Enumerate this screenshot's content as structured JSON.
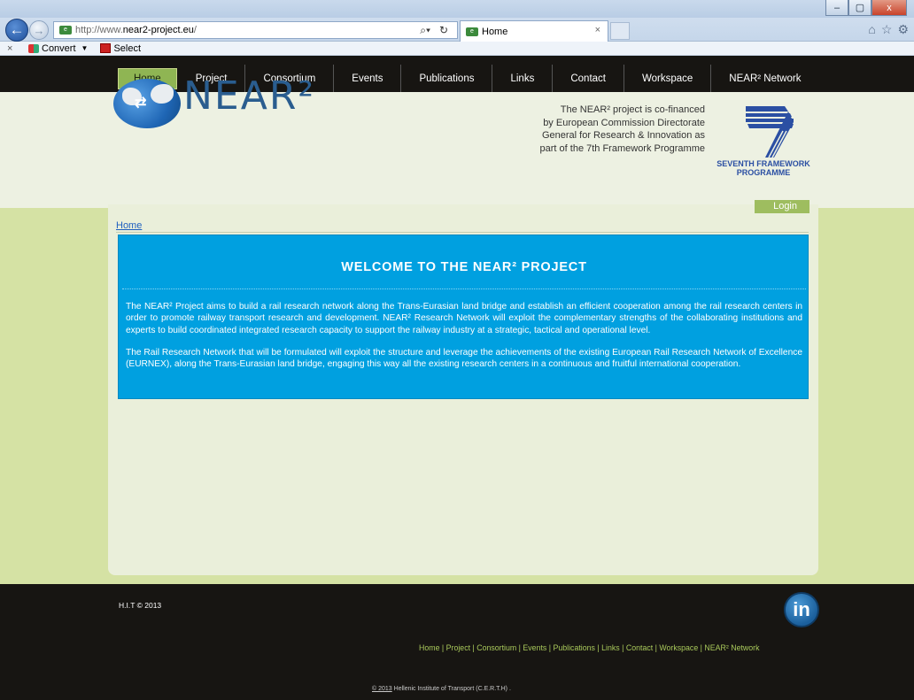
{
  "browser": {
    "url_prefix": "http://www.",
    "url_domain": "near2-project.eu",
    "url_suffix": "/",
    "tab_title": "Home",
    "window_controls": [
      "–",
      "▢",
      "x"
    ]
  },
  "command_bar": {
    "convert_label": "Convert",
    "select_label": "Select"
  },
  "site": {
    "nav": [
      "Home",
      "Project",
      "Consortium",
      "Events",
      "Publications",
      "Links",
      "Contact",
      "Workspace",
      "NEAR² Network"
    ],
    "active_nav": "Home",
    "logo_text": "NEAR²",
    "cofinance_lines": [
      "The NEAR² project is co-financed",
      "by European Commission Directorate",
      "General for Research & Innovation as",
      "part of the 7th Framework Programme"
    ],
    "fp7_label_line1": "SEVENTH FRAMEWORK",
    "fp7_label_line2": "PROGRAMME",
    "login_label": "Login",
    "breadcrumb": "Home",
    "welcome_title": "WELCOME TO THE NEAR² PROJECT",
    "welcome_p1": "The NEAR² Project aims to build a rail research network along the Trans-Eurasian land bridge and establish an efficient cooperation among the rail research centers in order to promote railway transport research and development. NEAR² Research Network will exploit the complementary strengths of the collaborating institutions and experts to build coordinated integrated research capacity to support the railway industry at a strategic, tactical and operational level.",
    "welcome_p2": "The Rail Research Network that will be formulated will exploit the structure and leverage the achievements of the existing European Rail Research Network of Excellence (EURNEX), along the Trans-Eurasian land bridge, engaging this way all the existing research centers in a continuous and fruitful international cooperation."
  },
  "footer": {
    "copyright": "H.I.T © 2013",
    "linkedin_label": "in",
    "links": [
      "Home",
      "Project",
      "Consortium",
      "Events",
      "Publications",
      "Links",
      "Contact",
      "Workspace",
      "NEAR² Network"
    ],
    "credit_year": "© 2013",
    "credit_text": " Hellenic Institute of Transport (C.E.R.T.H) ."
  }
}
